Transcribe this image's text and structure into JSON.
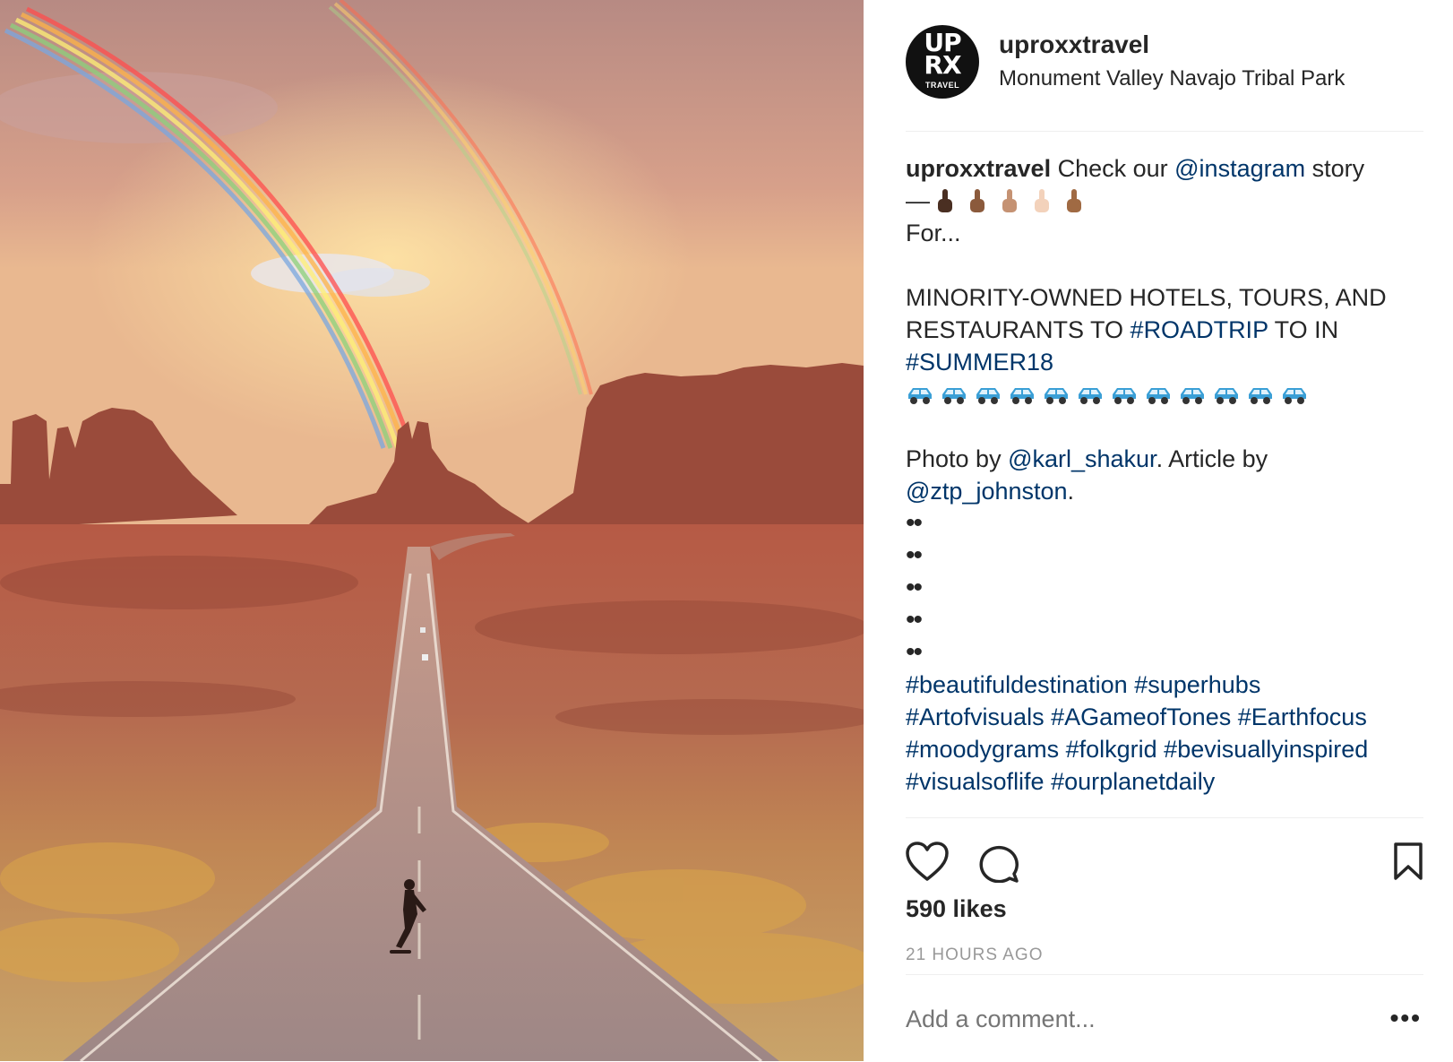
{
  "post": {
    "image_alt": "",
    "header": {
      "avatar_line1": "UP",
      "avatar_line2": "RX",
      "avatar_line3": "TRAVEL",
      "username": "uproxxtravel",
      "location": "Monument Valley Navajo Tribal Park"
    },
    "caption": {
      "username": "uproxxtravel",
      "text1": " Check our ",
      "mention_instagram": "@instagram",
      "text2": " story",
      "dash": "—",
      "hand_colors": [
        "#4a2f22",
        "#8b5a3c",
        "#c59273",
        "#f3d2bb",
        "#a06a43"
      ],
      "for_text": "For...",
      "headline1": "MINORITY-OWNED HOTELS, TOURS, AND",
      "headline2_a": "RESTAURANTS TO ",
      "hashtag_roadtrip": "#ROADTRIP",
      "headline2_b": " TO IN",
      "hashtag_summer": "#SUMMER18",
      "car_count": 12,
      "car_color": "#3a9fd6",
      "photo_by": "Photo by ",
      "mention_karl": "@karl_shakur",
      "article_by": ". Article by",
      "mention_ztp": "@ztp_johnston",
      "period": ".",
      "dot_line": "••",
      "tags_line1": [
        "#beautifuldestination",
        "#superhubs"
      ],
      "tags_line2": [
        "#Artofvisuals",
        "#AGameofTones",
        "#Earthfocus"
      ],
      "tags_line3": [
        "#moodygrams",
        "#folkgrid",
        "#bevisuallyinspired"
      ],
      "tags_line4": [
        "#visualsoflife",
        "#ourplanetdaily"
      ]
    },
    "actions": {
      "like_icon": "heart-icon",
      "comment_icon": "comment-bubble-icon",
      "save_icon": "bookmark-icon",
      "likes": "590 likes",
      "time": "21 HOURS AGO"
    },
    "comment": {
      "placeholder": "Add a comment...",
      "more": "•••"
    }
  },
  "colors": {
    "link": "#003569",
    "text": "#262626",
    "muted": "#999999",
    "divider": "#efefef"
  }
}
